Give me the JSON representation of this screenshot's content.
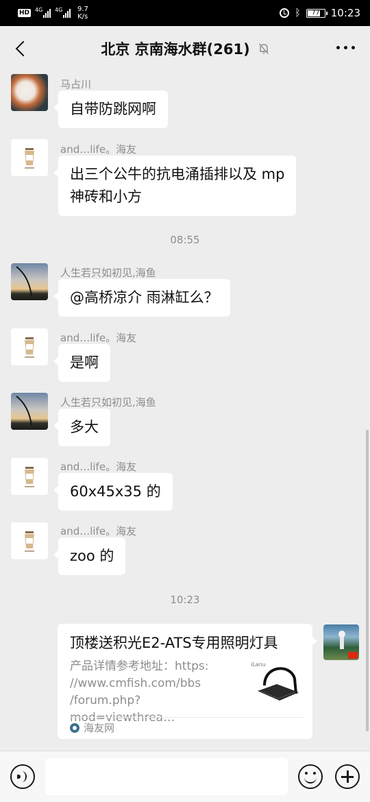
{
  "status_bar": {
    "hd_badge": "HD",
    "network_1": "4G",
    "network_2": "4G",
    "speed_value": "9.7",
    "speed_unit": "K/s",
    "battery": "77",
    "time": "10:23",
    "icons": [
      "alarm-icon",
      "bluetooth-icon",
      "battery-icon"
    ]
  },
  "header": {
    "title": "北京 京南海水群(261)",
    "icons": [
      "back-icon",
      "mute-icon",
      "more-icon"
    ]
  },
  "messages": [
    {
      "sender": "马占川",
      "text": "自带防跳网啊",
      "avatar": "fish-avatar"
    },
    {
      "sender": "and…life。海友",
      "text": "出三个公牛的抗电涌插排以及 mp\n神砖和小方",
      "avatar": "cup-avatar"
    },
    {
      "time": "08:55"
    },
    {
      "sender": "人生若只如初见,海鱼",
      "text": "@高桥凉介  雨淋缸么？",
      "avatar": "sunset-avatar"
    },
    {
      "sender": "and…life。海友",
      "text": "是啊",
      "avatar": "cup-avatar"
    },
    {
      "sender": "人生若只如初见,海鱼",
      "text": "多大",
      "avatar": "sunset-avatar"
    },
    {
      "sender": "and…life。海友",
      "text": "60x45x35 的",
      "avatar": "cup-avatar"
    },
    {
      "sender": "and…life。海友",
      "text": "zoo 的",
      "avatar": "cup-avatar"
    },
    {
      "time": "10:23"
    }
  ],
  "link_card": {
    "title": "顶楼送积光E2-ATS专用照明灯具",
    "description": "产品详情参考地址：https:\n//www.cmfish.com/bbs\n/forum.php?mod=viewthrea…",
    "thumb_text": "iLanu",
    "source": "海友网"
  },
  "input_bar": {
    "placeholder": "",
    "icons": [
      "voice-icon",
      "emoji-icon",
      "plus-icon"
    ]
  }
}
